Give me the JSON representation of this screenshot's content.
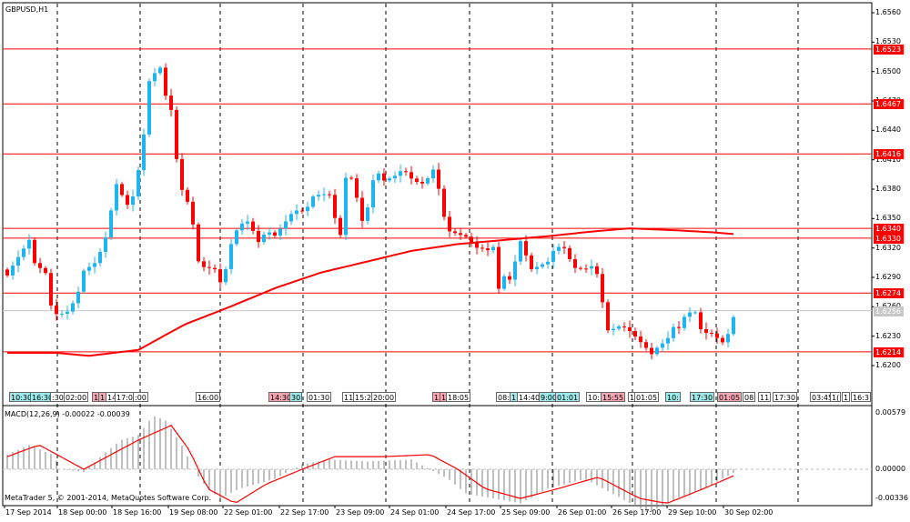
{
  "window": {
    "symbol_label": "GBPUSD,H1"
  },
  "colors": {
    "bull": "#1EB4F0",
    "bear": "#FF0000",
    "level": "#FF0000",
    "ma": "#FF0000",
    "current": "#C8C8C8",
    "macd_hist": "#808080",
    "macd_signal": "#FF0000",
    "tag_cyan": "#9EEAEA",
    "tag_pink": "#F4A6B2"
  },
  "price_axis": {
    "ticks": [
      "1.6560",
      "1.6530",
      "1.6500",
      "1.6470",
      "1.6440",
      "1.6410",
      "1.6380",
      "1.6350",
      "1.6320",
      "1.6290",
      "1.6260",
      "1.6230",
      "1.6200"
    ]
  },
  "levels": [
    {
      "price": 1.6523,
      "label": "1.6523"
    },
    {
      "price": 1.6467,
      "label": "1.6467"
    },
    {
      "price": 1.6416,
      "label": "1.6416"
    },
    {
      "price": 1.634,
      "label": "1.6340"
    },
    {
      "price": 1.633,
      "label": "1.6330"
    },
    {
      "price": 1.6274,
      "label": "1.6274"
    },
    {
      "price": 1.6214,
      "label": "1.6214"
    }
  ],
  "current_price": {
    "price": 1.6256,
    "label": "1.6256"
  },
  "time_axis": {
    "labels": [
      "17 Sep 2014",
      "18 Sep 00:00",
      "18 Sep 16:00",
      "19 Sep 08:00",
      "22 Sep 01:00",
      "22 Sep 17:00",
      "23 Sep 09:00",
      "24 Sep 01:00",
      "24 Sep 17:00",
      "25 Sep 09:00",
      "26 Sep 01:00",
      "26 Sep 17:00",
      "29 Sep 10:00",
      "30 Sep 02:00"
    ]
  },
  "event_tags": [
    {
      "text": "10:30",
      "color": "cyan"
    },
    {
      "text": "16:30",
      "color": "cyan"
    },
    {
      "text": ":30",
      "color": "white"
    },
    {
      "text": "02:00",
      "color": "white"
    },
    {
      "text": "1",
      "color": "pink"
    },
    {
      "text": "1",
      "color": "pink"
    },
    {
      "text": "14",
      "color": "white"
    },
    {
      "text": "17:00",
      "color": "white"
    },
    {
      "text": ":00",
      "color": "white"
    },
    {
      "text": "16:00",
      "color": "white"
    },
    {
      "text": "14:30",
      "color": "pink"
    },
    {
      "text": "30",
      "color": "cyan"
    },
    {
      "text": "01:30",
      "color": "white"
    },
    {
      "text": "11",
      "color": "white"
    },
    {
      "text": "15:2",
      "color": "white"
    },
    {
      "text": "20:00",
      "color": "white"
    },
    {
      "text": "13",
      "color": "pink"
    },
    {
      "text": "1",
      "color": "pink"
    },
    {
      "text": "18:05",
      "color": "white"
    },
    {
      "text": "08:0",
      "color": "white"
    },
    {
      "text": "1",
      "color": "cyan"
    },
    {
      "text": "14:40",
      "color": "white"
    },
    {
      "text": "9:00",
      "color": "cyan"
    },
    {
      "text": "01:01",
      "color": "cyan"
    },
    {
      "text": "10:",
      "color": "white"
    },
    {
      "text": "15:55",
      "color": "pink"
    },
    {
      "text": "1",
      "color": "white"
    },
    {
      "text": "01:05",
      "color": "white"
    },
    {
      "text": "10:",
      "color": "cyan"
    },
    {
      "text": "17:30",
      "color": "cyan"
    },
    {
      "text": "01:05",
      "color": "pink"
    },
    {
      "text": "08",
      "color": "white"
    },
    {
      "text": "11",
      "color": "white"
    },
    {
      "text": "17:30",
      "color": "white"
    },
    {
      "text": "03:45",
      "color": "white"
    },
    {
      "text": "1(",
      "color": "white"
    },
    {
      "text": "1",
      "color": "white"
    },
    {
      "text": "16:3",
      "color": "white"
    }
  ],
  "macd": {
    "label": "MACD(12,26,9) -0.00022 -0.00039",
    "axis": {
      "max_label": "0.00579",
      "zero_label": "0.00000",
      "min_label": "-0.00336",
      "max": 0.00579,
      "min": -0.00336
    }
  },
  "copyright": "MetaTrader 5, © 2001-2014, MetaQuotes Software Corp.",
  "chart_data": {
    "type": "candlestick",
    "title": "GBPUSD,H1",
    "ylim": [
      1.6195,
      1.6566
    ],
    "bars": 134,
    "close_keypoints": [
      [
        0,
        1.6295
      ],
      [
        1,
        1.6299
      ],
      [
        2.5,
        1.6313
      ],
      [
        4,
        1.6327
      ],
      [
        5,
        1.6304
      ],
      [
        7,
        1.6295
      ],
      [
        7.5,
        1.6267
      ],
      [
        8.5,
        1.6258
      ],
      [
        9.2,
        1.6253
      ],
      [
        11,
        1.6258
      ],
      [
        12.5,
        1.6262
      ],
      [
        14,
        1.6295
      ],
      [
        16,
        1.6304
      ],
      [
        17.5,
        1.6322
      ],
      [
        18.5,
        1.6341
      ],
      [
        19.5,
        1.6378
      ],
      [
        20,
        1.6387
      ],
      [
        21.7,
        1.6369
      ],
      [
        22.5,
        1.6364
      ],
      [
        23.3,
        1.6373
      ],
      [
        24,
        1.6397
      ],
      [
        25,
        1.6434
      ],
      [
        26,
        1.6489
      ],
      [
        26.7,
        1.6503
      ],
      [
        27.5,
        1.6489
      ],
      [
        28.3,
        1.6513
      ],
      [
        29,
        1.6476
      ],
      [
        30,
        1.6462
      ],
      [
        30.8,
        1.6452
      ],
      [
        31.2,
        1.6373
      ],
      [
        32.5,
        1.6387
      ],
      [
        33.3,
        1.636
      ],
      [
        34,
        1.6341
      ],
      [
        35,
        1.6304
      ],
      [
        36.7,
        1.6295
      ],
      [
        37.5,
        1.6304
      ],
      [
        39,
        1.6285
      ],
      [
        40,
        1.6299
      ],
      [
        40.8,
        1.6322
      ],
      [
        41.7,
        1.6336
      ],
      [
        42.5,
        1.6346
      ],
      [
        44,
        1.635
      ],
      [
        45.8,
        1.6322
      ],
      [
        47.5,
        1.6336
      ],
      [
        49,
        1.6332
      ],
      [
        50.8,
        1.6346
      ],
      [
        52.5,
        1.636
      ],
      [
        54,
        1.636
      ],
      [
        55.8,
        1.6369
      ],
      [
        57.5,
        1.6373
      ],
      [
        59,
        1.6373
      ],
      [
        60,
        1.635
      ],
      [
        60.8,
        1.6318
      ],
      [
        61.7,
        1.6387
      ],
      [
        62.5,
        1.6401
      ],
      [
        63.3,
        1.6387
      ],
      [
        64,
        1.6373
      ],
      [
        65,
        1.635
      ],
      [
        65.8,
        1.636
      ],
      [
        67.5,
        1.6397
      ],
      [
        69,
        1.6387
      ],
      [
        70.8,
        1.6392
      ],
      [
        72.5,
        1.6401
      ],
      [
        74,
        1.6392
      ],
      [
        75.8,
        1.6387
      ],
      [
        77.5,
        1.6397
      ],
      [
        78.3,
        1.6397
      ],
      [
        79,
        1.6378
      ],
      [
        80,
        1.635
      ],
      [
        80.8,
        1.6336
      ],
      [
        82.5,
        1.6334
      ],
      [
        84,
        1.6332
      ],
      [
        85.8,
        1.6322
      ],
      [
        87.5,
        1.6322
      ],
      [
        89,
        1.6318
      ],
      [
        90,
        1.6276
      ],
      [
        90.8,
        1.629
      ],
      [
        92.5,
        1.6285
      ],
      [
        93.3,
        1.6318
      ],
      [
        94,
        1.6327
      ],
      [
        95,
        1.6313
      ],
      [
        95.8,
        1.6299
      ],
      [
        97.5,
        1.6304
      ],
      [
        99,
        1.6309
      ],
      [
        100.8,
        1.6318
      ],
      [
        101.7,
        1.6321
      ],
      [
        102.5,
        1.6313
      ],
      [
        103.3,
        1.6304
      ],
      [
        104,
        1.6299
      ],
      [
        105.8,
        1.6299
      ],
      [
        107.5,
        1.6304
      ],
      [
        108.3,
        1.629
      ],
      [
        109,
        1.6267
      ],
      [
        110,
        1.6239
      ],
      [
        110.8,
        1.6234
      ],
      [
        112.5,
        1.6239
      ],
      [
        114,
        1.6234
      ],
      [
        115.8,
        1.6225
      ],
      [
        117.5,
        1.6216
      ],
      [
        118.3,
        1.6211
      ],
      [
        119,
        1.622
      ],
      [
        120,
        1.6225
      ],
      [
        120.8,
        1.623
      ],
      [
        122.5,
        1.6239
      ],
      [
        123.3,
        1.6234
      ],
      [
        124,
        1.6248
      ],
      [
        125,
        1.6253
      ],
      [
        125.8,
        1.6258
      ],
      [
        126.7,
        1.6239
      ],
      [
        127.5,
        1.6234
      ],
      [
        129,
        1.6234
      ],
      [
        130,
        1.623
      ],
      [
        130.8,
        1.6225
      ],
      [
        131.7,
        1.623
      ],
      [
        132.5,
        1.6244
      ],
      [
        133.3,
        1.6248
      ]
    ],
    "ma_keypoints": [
      [
        0,
        1.6213
      ],
      [
        9,
        1.6213
      ],
      [
        15,
        1.621
      ],
      [
        24,
        1.6216
      ],
      [
        32.5,
        1.6242
      ],
      [
        40.8,
        1.626
      ],
      [
        49,
        1.6279
      ],
      [
        57.5,
        1.6295
      ],
      [
        65.8,
        1.6306
      ],
      [
        74,
        1.6317
      ],
      [
        82.5,
        1.6324
      ],
      [
        90.8,
        1.6328
      ],
      [
        99,
        1.6332
      ],
      [
        107.5,
        1.6337
      ],
      [
        114,
        1.634
      ],
      [
        122.5,
        1.6338
      ],
      [
        129,
        1.6336
      ],
      [
        133.3,
        1.6334
      ]
    ],
    "macd_hist_keypoints": [
      [
        0,
        0.0015
      ],
      [
        4,
        0.0025
      ],
      [
        8.3,
        0.0015
      ],
      [
        10,
        0.0
      ],
      [
        14,
        -0.0003
      ],
      [
        17.5,
        0.0015
      ],
      [
        20.8,
        0.003
      ],
      [
        24,
        0.0035
      ],
      [
        26.7,
        0.0055
      ],
      [
        29,
        0.005
      ],
      [
        32.5,
        0.002
      ],
      [
        34,
        0.0
      ],
      [
        36.7,
        -0.002
      ],
      [
        39,
        -0.003
      ],
      [
        42.5,
        -0.002
      ],
      [
        49,
        -0.001
      ],
      [
        54,
        0.0005
      ],
      [
        59,
        0.001
      ],
      [
        65.8,
        0.0008
      ],
      [
        74,
        0.001
      ],
      [
        80.8,
        -0.001
      ],
      [
        84,
        -0.0025
      ],
      [
        89,
        -0.003
      ],
      [
        94,
        -0.0035
      ],
      [
        99,
        -0.002
      ],
      [
        105.8,
        -0.001
      ],
      [
        112.5,
        -0.003
      ],
      [
        117.5,
        -0.0045
      ],
      [
        122.5,
        -0.003
      ],
      [
        127.5,
        -0.002
      ],
      [
        133.3,
        -0.0003
      ]
    ],
    "macd_signal_keypoints": [
      [
        0,
        0.0013
      ],
      [
        5.8,
        0.0025
      ],
      [
        14,
        0.0
      ],
      [
        24,
        0.003
      ],
      [
        30,
        0.0045
      ],
      [
        33.3,
        0.002
      ],
      [
        36.7,
        -0.002
      ],
      [
        41.7,
        -0.0035
      ],
      [
        47.5,
        -0.0015
      ],
      [
        54,
        0.0
      ],
      [
        60,
        0.0013
      ],
      [
        69,
        0.0013
      ],
      [
        77.5,
        0.0015
      ],
      [
        82.5,
        0.0
      ],
      [
        87.5,
        -0.002
      ],
      [
        94,
        -0.003
      ],
      [
        100.8,
        -0.002
      ],
      [
        108.3,
        -0.0008
      ],
      [
        115.8,
        -0.003
      ],
      [
        120.8,
        -0.0035
      ],
      [
        127.5,
        -0.002
      ],
      [
        133.3,
        -0.0006
      ]
    ]
  }
}
